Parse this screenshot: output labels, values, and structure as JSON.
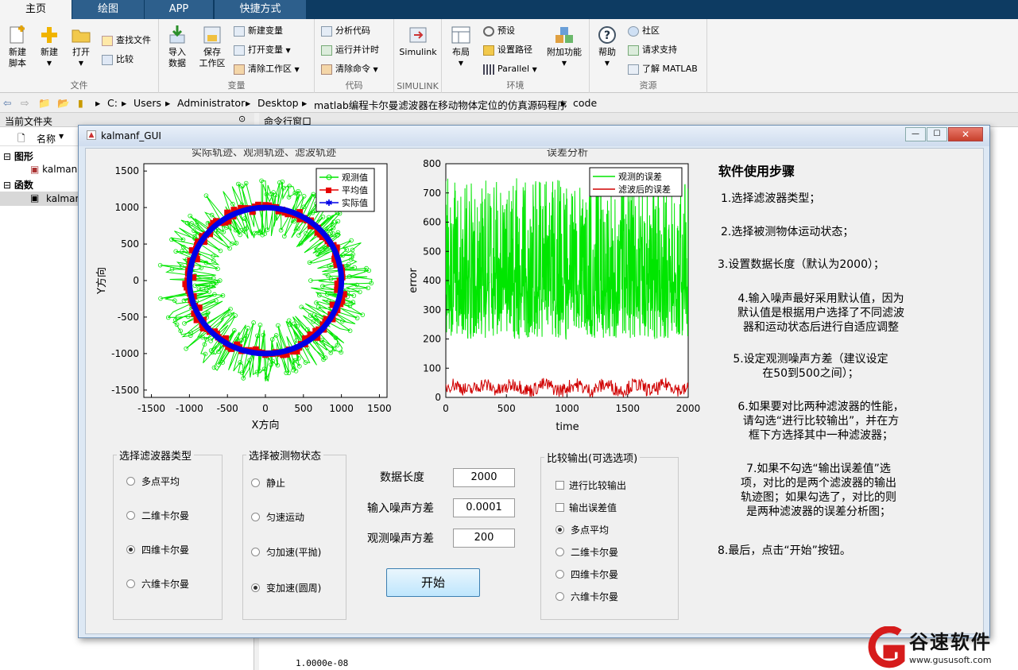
{
  "tabs": [
    "主页",
    "绘图",
    "APP",
    "快捷方式"
  ],
  "ribbon": {
    "file": {
      "new_script": "新建\n脚本",
      "new": "新建",
      "open": "打开",
      "find_files": "查找文件",
      "compare": "比较",
      "label": "文件"
    },
    "variable": {
      "import": "导入\n数据",
      "save_ws": "保存\n工作区",
      "new_var": "新建变量",
      "open_var": "打开变量",
      "clear_ws": "清除工作区",
      "label": "变量"
    },
    "code": {
      "analyze": "分析代码",
      "run_time": "运行并计时",
      "clear_cmd": "清除命令",
      "label": "代码"
    },
    "simulink": {
      "btn": "Simulink",
      "label": "SIMULINK"
    },
    "env": {
      "layout": "布局",
      "prefs": "预设",
      "set_path": "设置路径",
      "parallel": "Parallel",
      "addons": "附加功能",
      "label": "环境"
    },
    "resources": {
      "help": "帮助",
      "community": "社区",
      "support": "请求支持",
      "learn": "了解 MATLAB",
      "label": "资源"
    }
  },
  "address": [
    "C:",
    "Users",
    "Administrator",
    "Desktop",
    "matlab编程卡尔曼滤波器在移动物体定位的仿真源码程序",
    "code"
  ],
  "left_panel": {
    "title": "当前文件夹",
    "col_name": "名称",
    "group_fig": "图形",
    "item_fig": "kalman",
    "group_func": "函数",
    "item_func": "kalman"
  },
  "cmd_window": {
    "title": "命令行窗口",
    "output": "1.0000e-08"
  },
  "gui": {
    "title": "kalmanf_GUI",
    "filter_group": {
      "title": "选择滤波器类型",
      "options": [
        "多点平均",
        "二维卡尔曼",
        "四维卡尔曼",
        "六维卡尔曼"
      ],
      "selected": 2
    },
    "motion_group": {
      "title": "选择被测物状态",
      "options": [
        "静止",
        "匀速运动",
        "匀加速(平抛)",
        "变加速(圆周)"
      ],
      "selected": 3
    },
    "params": {
      "len_label": "数据长度",
      "len_value": "2000",
      "in_noise_label": "输入噪声方差",
      "in_noise_value": "0.0001",
      "obs_noise_label": "观测噪声方差",
      "obs_noise_value": "200"
    },
    "start_button": "开始",
    "compare_group": {
      "title": "比较输出(可选选项)",
      "checks": [
        "进行比较输出",
        "输出误差值"
      ],
      "options": [
        "多点平均",
        "二维卡尔曼",
        "四维卡尔曼",
        "六维卡尔曼"
      ],
      "selected": 0
    },
    "steps_title": "软件使用步骤",
    "steps": [
      "1.选择滤波器类型；",
      "2.选择被测物体运动状态；",
      "3.设置数据长度（默认为2000）；",
      "4.输入噪声最好采用默认值，因为\n默认值是根据用户选择了不同滤波\n器和运动状态后进行自适应调整\n的",
      "5.设定观测噪声方差（建议设定\n在50到500之间）；",
      "6.如果要对比两种滤波器的性能，\n请勾选“进行比较输出”，并在方\n框下方选择其中一种滤波器；",
      "7.如果不勾选“输出误差值”选\n项，对比的是两个滤波器的输出\n轨迹图；如果勾选了，对比的则\n是两种滤波器的误差分析图；",
      "8.最后，点击“开始”按钮。"
    ]
  },
  "watermark": {
    "name": "谷速软件",
    "url": "www.gususoft.com"
  },
  "chart_data": [
    {
      "type": "scatter",
      "title": "实际轨迹、观测轨迹、滤波轨迹",
      "xlabel": "X方向",
      "ylabel": "Y方向",
      "xlim": [
        -1600,
        1600
      ],
      "ylim": [
        -1600,
        1600
      ],
      "xticks": [
        -1500,
        -1000,
        -500,
        0,
        500,
        1000,
        1500
      ],
      "yticks": [
        1500,
        1000,
        500,
        0,
        -500,
        -1000,
        -1500
      ],
      "legend": [
        "观测值",
        "平均值",
        "实际值"
      ],
      "legend_position": "top-right",
      "series": [
        {
          "name": "观测值",
          "color": "#00e600",
          "radius_center": 1000,
          "radius_spread": 450
        },
        {
          "name": "平均值",
          "color": "#e60000",
          "radius": 1000
        },
        {
          "name": "实际值",
          "color": "#0000e6",
          "radius": 1000
        }
      ]
    },
    {
      "type": "line",
      "title": "误差分析",
      "xlabel": "time",
      "ylabel": "error",
      "xlim": [
        0,
        2000
      ],
      "ylim": [
        0,
        800
      ],
      "xticks": [
        0,
        500,
        1000,
        1500,
        2000
      ],
      "yticks": [
        800,
        700,
        600,
        500,
        400,
        300,
        200,
        100,
        0
      ],
      "legend": [
        "观测的误差",
        "滤波后的误差"
      ],
      "legend_position": "top-right",
      "series": [
        {
          "name": "观测的误差",
          "color": "#00e600",
          "typical_range": [
            200,
            750
          ]
        },
        {
          "name": "滤波后的误差",
          "color": "#d00000",
          "typical_range": [
            10,
            90
          ]
        }
      ]
    }
  ]
}
